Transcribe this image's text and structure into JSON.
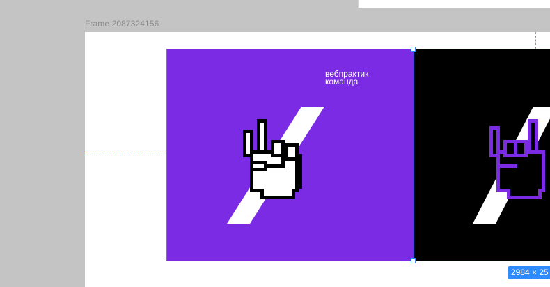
{
  "canvas": {
    "frame_label": "Frame 2087324156",
    "dimensions_badge": "2984 × 25"
  },
  "artboard_purple": {
    "brand_line1": "вебпрактик",
    "brand_line2": "команда",
    "background": "#7a2be3",
    "icon": "peace-hand-cursor-icon"
  },
  "artboard_black": {
    "background": "#000000",
    "icon": "rock-hand-cursor-icon"
  },
  "colors": {
    "selection": "#2f8cff",
    "canvas_bg": "#c4c4c4",
    "frame_bg": "#ffffff"
  }
}
